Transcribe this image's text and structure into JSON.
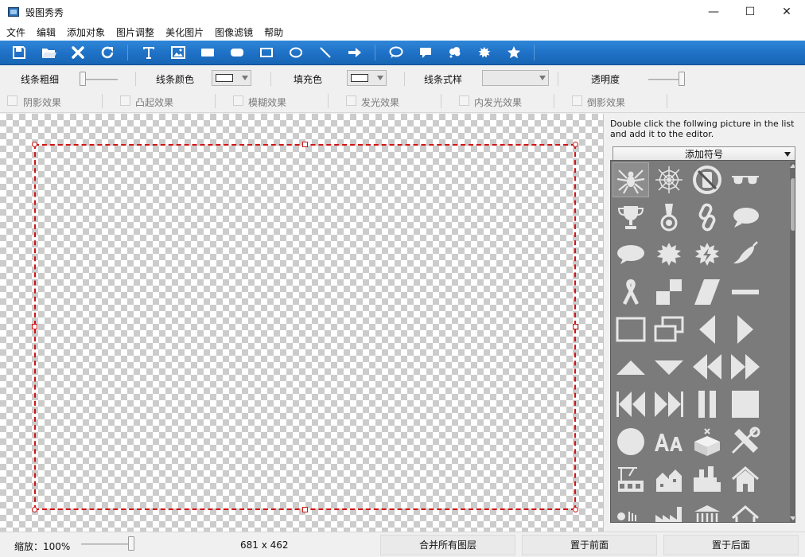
{
  "window": {
    "title": "毁图秀秀",
    "minimize": "—",
    "maximize": "☐",
    "close": "✕"
  },
  "menu": [
    "文件",
    "编辑",
    "添加对象",
    "图片调整",
    "美化图片",
    "图像滤镜",
    "帮助"
  ],
  "toolbar": {
    "icons": [
      "save-icon",
      "open-folder-icon",
      "delete-icon",
      "refresh-icon",
      "text-icon",
      "image-icon",
      "rectangle-icon",
      "rounded-rectangle-icon",
      "rectangle-outline-icon",
      "ellipse-icon",
      "line-icon",
      "arrow-icon",
      "speech-bubble-icon",
      "callout-icon",
      "thought-cloud-icon",
      "burst-icon",
      "star-icon"
    ],
    "color": "#1d6fc4"
  },
  "properties": {
    "line_width_label": "线条粗细",
    "line_color_label": "线条颜色",
    "fill_color_label": "填充色",
    "line_style_label": "线条式样",
    "opacity_label": "透明度",
    "opacity": 1.0,
    "line_width": 0.0
  },
  "effects": [
    "阴影效果",
    "凸起效果",
    "模糊效果",
    "发光效果",
    "内发光效果",
    "倒影效果"
  ],
  "canvas": {
    "selection_color": "#d01414"
  },
  "side_panel": {
    "hint": "Double click the follwing picture in the list and add it to the editor.",
    "category": "添加符号",
    "symbols": [
      "spider-icon",
      "spider-web-icon",
      "no-phone-icon",
      "sunglasses-icon",
      "trophy-icon",
      "medal-icon",
      "chain-link-icon",
      "speech-bubble-icon",
      "oval-bubble-icon",
      "burst-icon",
      "lightning-burst-icon",
      "chili-pepper-icon",
      "ribbon-icon",
      "checker-squares-icon",
      "parallelogram-icon",
      "dash-icon",
      "rectangle-icon",
      "double-rectangle-icon",
      "triangle-left-icon",
      "triangle-right-icon",
      "triangle-up-icon",
      "triangle-down-icon",
      "rewind-icon",
      "fast-forward-icon",
      "skip-back-icon",
      "skip-forward-icon",
      "pause-icon",
      "stop-icon",
      "circle-icon",
      "font-size-icon",
      "box-icon",
      "tools-icon",
      "construction-icon",
      "town-icon",
      "city-icon",
      "house-icon",
      "dots-icon",
      "factory-icon",
      "temple-icon",
      "home-icon"
    ]
  },
  "status": {
    "zoom": "缩放：100%",
    "size": "681 x 462",
    "merge_layers": "合并所有图层",
    "bring_front": "置于前面",
    "send_back": "置于后面"
  }
}
